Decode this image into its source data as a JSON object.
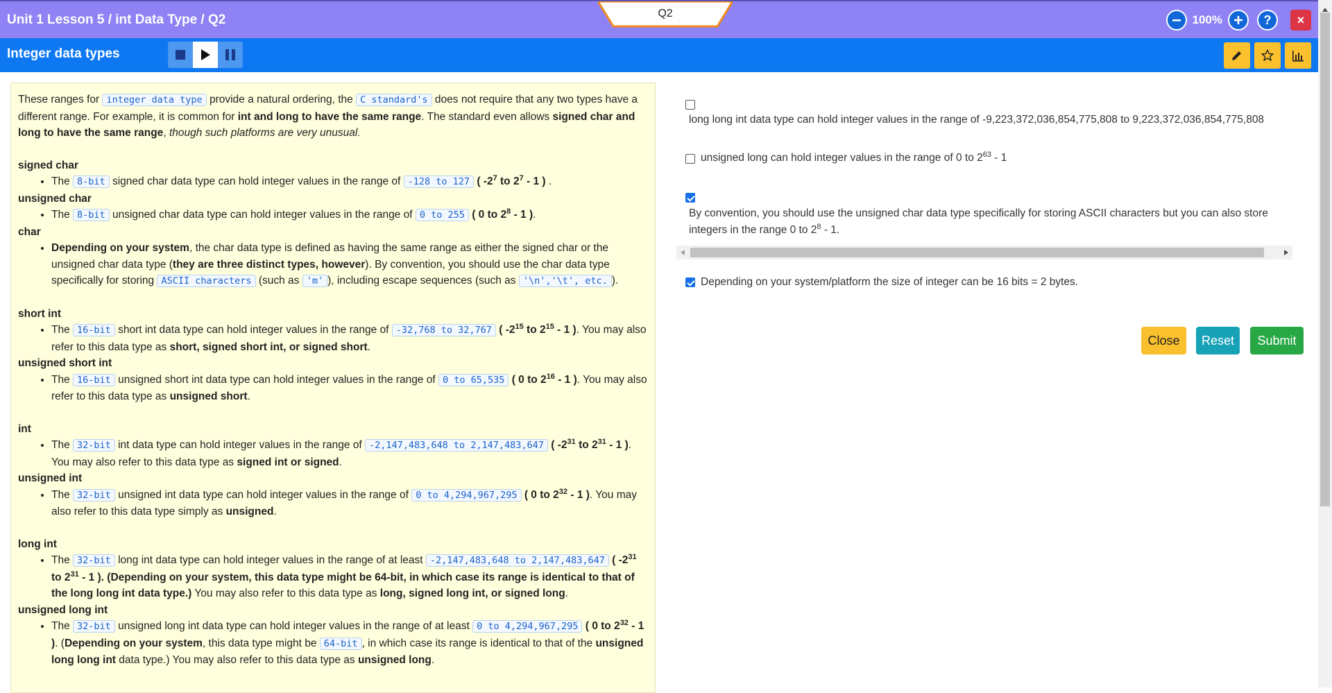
{
  "header": {
    "breadcrumb": "Unit 1 Lesson 5 / int Data Type / Q2",
    "question_tab": "Q2",
    "zoom_level": "100%",
    "help_label": "?",
    "close_label": "×"
  },
  "subheader": {
    "title": "Integer data types"
  },
  "colors": {
    "topbar": "#8f82f4",
    "bluebar": "#0d78f2",
    "content_bg": "#ffffdd",
    "close": "#fbc02d",
    "reset": "#17a2b8",
    "submit": "#28a745",
    "window_close": "#dc3545"
  },
  "content": {
    "intro": {
      "t1": "These ranges for ",
      "c1": "integer data type",
      "t2": " provide a natural ordering, the ",
      "c2": "C standard's",
      "t3": " does not require that any two types have a different range. For example, it is common for ",
      "b1": "int and long to have the same range",
      "t4": ". The standard even allows ",
      "b2": "signed char and long to have the same range",
      "t5": ", ",
      "i1": "though such platforms are very unusual."
    },
    "signed_char": {
      "heading": "signed char",
      "t1": "The ",
      "c1": "8-bit",
      "t2": " signed char data type can hold integer values in the range of ",
      "c2": "-128 to 127",
      "b1": " ( -2",
      "s1": "7",
      "b2": " to 2",
      "s2": "7",
      "b3": " - 1 )",
      "t3": " ."
    },
    "unsigned_char": {
      "heading": "unsigned char",
      "t1": "The ",
      "c1": "8-bit",
      "t2": " unsigned char data type can hold integer values in the range of ",
      "c2": "0 to 255",
      "b1": " ( 0 to 2",
      "s1": "8",
      "b2": " - 1 )",
      "t3": "."
    },
    "char": {
      "heading": "char",
      "b1": "Depending on your system",
      "t1": ", the char data type is defined as having the same range as either the signed char or the unsigned char data type (",
      "b2": "they are three distinct types, however",
      "t2": "). By convention, you should use the char data type specifically for storing ",
      "c1": "ASCII characters",
      "t3": " (such as ",
      "c2": "'m'",
      "t4": "), including escape sequences (such as ",
      "c3": "'\\n','\\t', etc.",
      "t5": ")."
    },
    "short_int": {
      "heading": "short int",
      "t1": "The ",
      "c1": "16-bit",
      "t2": " short int data type can hold integer values in the range of ",
      "c2": "-32,768 to 32,767",
      "b1": " ( -2",
      "s1": "15",
      "b2": " to 2",
      "s2": "15",
      "b3": " - 1 )",
      "t3": ". You may also refer to this data type as ",
      "b4": "short, signed short int, or signed short",
      "t4": "."
    },
    "unsigned_short_int": {
      "heading": "unsigned short int",
      "t1": "The ",
      "c1": "16-bit",
      "t2": " unsigned short int data type can hold integer values in the range of ",
      "c2": "0 to 65,535",
      "b1": " ( 0 to 2",
      "s1": "16",
      "b2": " - 1 )",
      "t3": ". You may also refer to this data type as ",
      "b3": "unsigned short",
      "t4": "."
    },
    "int": {
      "heading": "int",
      "t1": "The ",
      "c1": "32-bit",
      "t2": " int data type can hold integer values in the range of ",
      "c2": "-2,147,483,648 to 2,147,483,647",
      "b1": " ( -2",
      "s1": "31",
      "b2": " to 2",
      "s2": "31",
      "b3": " - 1 )",
      "t3": ". You may also refer to this data type as ",
      "b4": "signed int or signed",
      "t4": "."
    },
    "unsigned_int": {
      "heading": "unsigned int",
      "t1": "The ",
      "c1": "32-bit",
      "t2": " unsigned int data type can hold integer values in the range of ",
      "c2": "0 to 4,294,967,295",
      "b1": " ( 0 to 2",
      "s1": "32",
      "b2": " - 1 )",
      "t3": ". You may also refer to this data type simply as ",
      "b3": "unsigned",
      "t4": "."
    },
    "long_int": {
      "heading": "long int",
      "t1": "The ",
      "c1": "32-bit",
      "t2": " long int data type can hold integer values in the range of at least ",
      "c2": "-2,147,483,648 to 2,147,483,647",
      "b1": " ( -2",
      "s1": "31",
      "b2": " to 2",
      "s2": "31",
      "b3": " - 1 ).",
      "b4": " (Depending on your system, this data type might be 64-bit, in which case its range is identical to that of the long long int data type.)",
      "t3": " You may also refer to this data type as ",
      "b5": "long, signed long int, or signed long",
      "t4": "."
    },
    "unsigned_long_int": {
      "heading": "unsigned long int",
      "t1": "The ",
      "c1": "32-bit",
      "t2": " unsigned long int data type can hold integer values in the range of at least ",
      "c2": "0 to 4,294,967,295",
      "b1": " ( 0 to 2",
      "s1": "32",
      "b2": " - 1 )",
      "t3": ". (",
      "b3": "Depending on your system",
      "t4": ", this data type might be ",
      "c3": "64-bit",
      "t5": ", in which case its range is identical to that of the ",
      "b4": "unsigned long long int",
      "t6": " data type.) You may also refer to this data type as ",
      "b5": "unsigned long",
      "t7": "."
    }
  },
  "options": [
    {
      "text": "long long int data type can hold integer values in the range of -9,223,372,036,854,775,808 to 9,223,372,036,854,775,808",
      "checked": false
    },
    {
      "text_a": "unsigned long can hold integer values in the range of 0 to 2",
      "sup": "63",
      "text_b": " - 1",
      "checked": false
    },
    {
      "text_a": "By convention, you should use the unsigned char data type specifically for storing ASCII characters but you can also store integers in the range 0 to 2",
      "sup": "8",
      "text_b": " - 1.",
      "checked": true
    },
    {
      "text": "Depending on your system/platform the size of integer can be 16 bits = 2 bytes.",
      "checked": true
    }
  ],
  "buttons": {
    "close": "Close",
    "reset": "Reset",
    "submit": "Submit"
  }
}
